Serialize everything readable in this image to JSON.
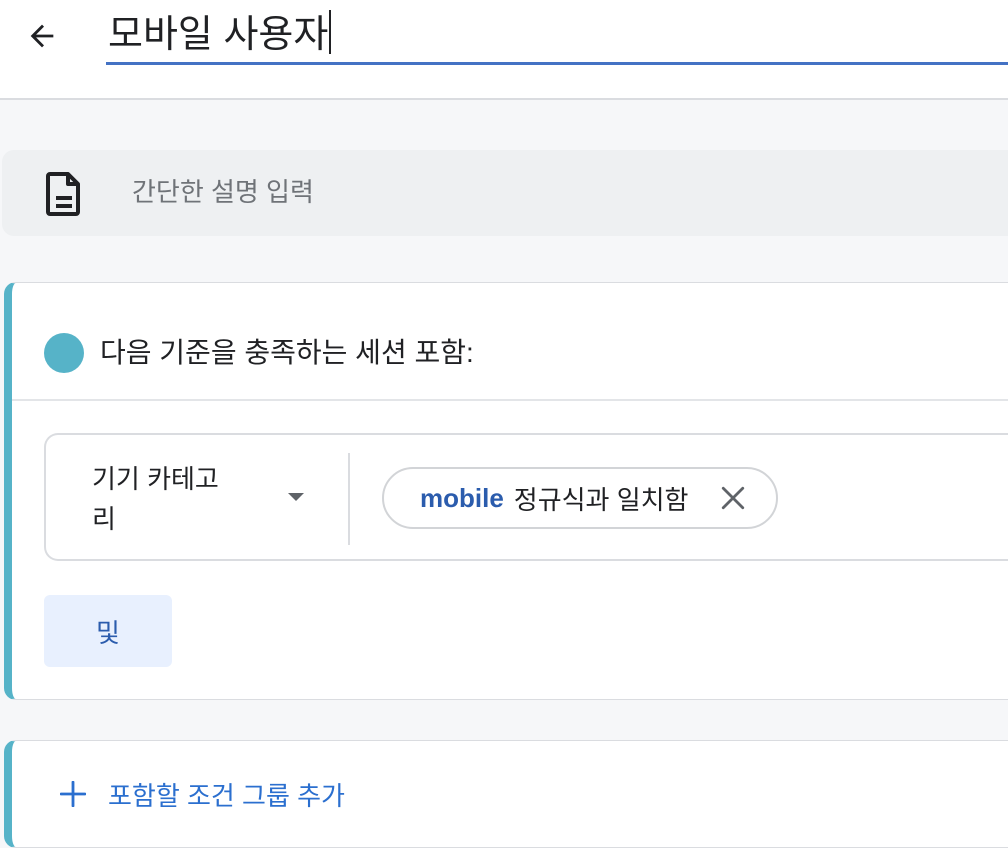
{
  "header": {
    "back_icon": "arrow-left-icon",
    "title": "모바일 사용자"
  },
  "description": {
    "icon": "document-icon",
    "placeholder": "간단한 설명 입력",
    "value": ""
  },
  "condition_group": {
    "title": "다음 기준을 충족하는 세션 포함:",
    "accent_color": "#56b3c8",
    "condition": {
      "dimension": "기기 카테고리",
      "dropdown_icon": "caret-down-icon",
      "chip": {
        "value": "mobile",
        "operator": "정규식과 일치함",
        "close_icon": "close-icon"
      }
    },
    "and_button": "및"
  },
  "add_group": {
    "icon": "plus-icon",
    "label": "포함할 조건 그룹 추가"
  }
}
